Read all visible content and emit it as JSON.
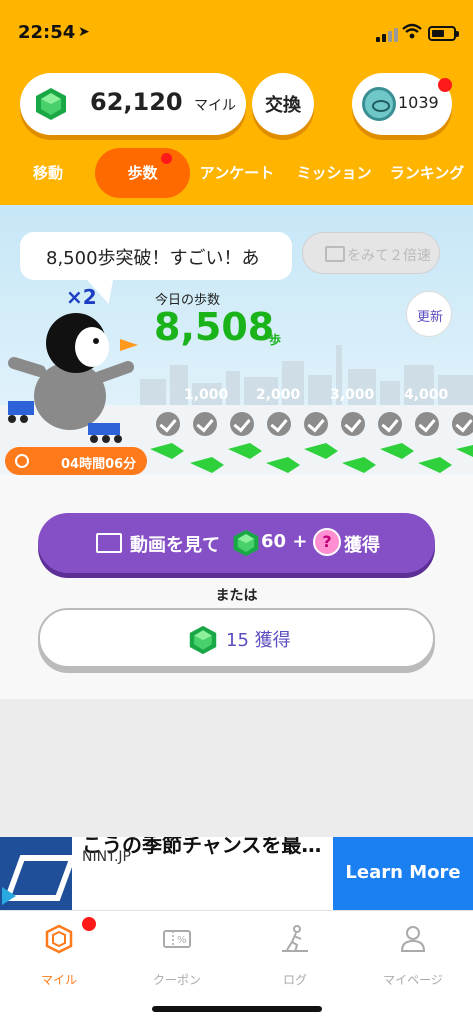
{
  "status": {
    "time": "22:54",
    "location_icon": "location-arrow-icon"
  },
  "header": {
    "miles_value": "62,120",
    "miles_unit": "マイル",
    "exchange_label": "交換",
    "coin_count": "1039"
  },
  "tabs": [
    {
      "label": "移動",
      "active": false,
      "badge": false
    },
    {
      "label": "歩数",
      "active": true,
      "badge": true
    },
    {
      "label": "アンケート",
      "active": false,
      "badge": false
    },
    {
      "label": "ミッション",
      "active": false,
      "badge": false
    },
    {
      "label": "ランキング",
      "active": false,
      "badge": false
    }
  ],
  "scene": {
    "speech": "8,500歩突破！すごい！あ",
    "double_button_label": "をみて２倍速",
    "multiplier": "×2",
    "today_steps_label": "今日の歩数",
    "today_steps_value": "8,508",
    "steps_unit": "歩",
    "refresh_label": "更新",
    "milestones": [
      "1,000",
      "2,000",
      "3,000",
      "4,000"
    ],
    "checked_count": 9,
    "timer_text": "04時間06分"
  },
  "actions": {
    "video_label": "動画を見て",
    "video_amount": "60 +",
    "video_bonus_symbol": "?",
    "video_get": "獲得",
    "or_label": "または",
    "plain_get_label": "15 獲得"
  },
  "ad": {
    "headline": "こうの季節チャンスを最…",
    "site": "NINT.JP",
    "cta": "Learn More"
  },
  "nav": [
    {
      "label": "マイル",
      "icon": "hexagon-gem-icon",
      "active": true,
      "badge": true
    },
    {
      "label": "クーポン",
      "icon": "coupon-icon",
      "active": false,
      "badge": false
    },
    {
      "label": "ログ",
      "icon": "walking-log-icon",
      "active": false,
      "badge": false
    },
    {
      "label": "マイページ",
      "icon": "person-icon",
      "active": false,
      "badge": false
    }
  ],
  "colors": {
    "header_bg": "#ffb400",
    "active_tab": "#ff6a00",
    "primary_purple": "#8550c6",
    "steps_green": "#1ab31a",
    "ad_cta": "#1a7ff0"
  }
}
